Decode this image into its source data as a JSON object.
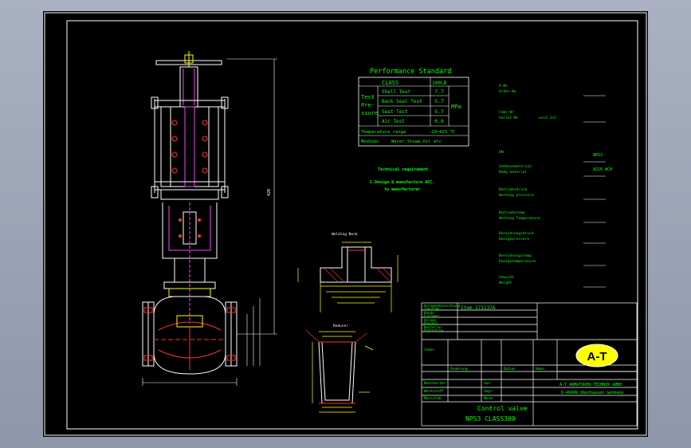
{
  "performance": {
    "title": "Performance Standard",
    "class_label": "CLASS",
    "class_value": "300LB",
    "test_label_1": "Test",
    "test_label_2": "Pre-",
    "test_label_3": "ssure",
    "unit": "MPa",
    "rows": [
      {
        "name": "Shell Test",
        "value": "7.7"
      },
      {
        "name": "Back Seal Test",
        "value": "5.7"
      },
      {
        "name": "Seat Test",
        "value": "5.7"
      },
      {
        "name": "Air Test",
        "value": "0.6"
      }
    ],
    "temp_label": "Temperature range",
    "temp_value": "-29~425 ℃",
    "medium_label": "Medium:",
    "medium_value": "Water,Steam,Oil etc"
  },
  "requirements": {
    "title": "Technical requirement",
    "line1": "1.Design & manufacture ACC.",
    "line2": "to manufacturer"
  },
  "fields": [
    {
      "de": "A-Nr",
      "en": "Order-No",
      "value": ""
    },
    {
      "de": "Fabr-Nr",
      "en": "Serial-Nr",
      "extra": "unit 1/2",
      "value": ""
    },
    {
      "de": "DN",
      "en": "",
      "value": "NPS3"
    },
    {
      "de": "Gehäusematerial",
      "en": "Body material",
      "value": "A216 WCB"
    },
    {
      "de": "Betriebsdruck",
      "en": "Working pressure",
      "value": ""
    },
    {
      "de": "Betriebstemp",
      "en": "Working Temperature",
      "value": ""
    },
    {
      "de": "Berechnungsdruck",
      "en": "Designpressure",
      "value": ""
    },
    {
      "de": "Berechnungstemp",
      "en": "Designtemperature",
      "value": ""
    },
    {
      "de": "Gewicht",
      "en": "Weight",
      "value": ""
    }
  ],
  "detail_labels": {
    "flange": "Welding Neck",
    "reducer": "Reducer",
    "height_dim": "420"
  },
  "title_block": {
    "row1_label": "Anlagenbezeichnung",
    "row1_sub": "Tekst/No",
    "row1_value": "Item 1721376",
    "row2_label": "Kunde",
    "row2_sub": "Customer",
    "row3_label": "Anlage",
    "row3_sub": "Project",
    "row4_label": "Besteller",
    "row4_sub": "Ordered by",
    "row5_label": "Index",
    "col_name": "Änderung",
    "col_date": "Datum",
    "col_name2": "Name",
    "r_drawn": "Bearbeiter",
    "r_checked": "Werkstoff",
    "r_scale": "Massstab",
    "r_gez": "Gez.",
    "r_gepr": "Gepr.",
    "r_norm": "Norm",
    "logo": "A-T",
    "company_line1": "A-T ARMATUREN-TECHNIK GMBH",
    "company_line2": "D-46049 Oberhausen Germany",
    "drawing_title_1": "Control valve",
    "drawing_title_2": "NPS3 CLASS300"
  },
  "colors": {
    "sheet": "#000000",
    "border": "#ffffff",
    "table": "#ffffff",
    "text_green": "#00ff00",
    "drawing_white": "#ffffff",
    "drawing_red": "#ff3030",
    "drawing_magenta": "#ff40ff",
    "drawing_yellow": "#ffff00",
    "drawing_cyan": "#00ffff",
    "logo_fill": "#ffff00"
  }
}
